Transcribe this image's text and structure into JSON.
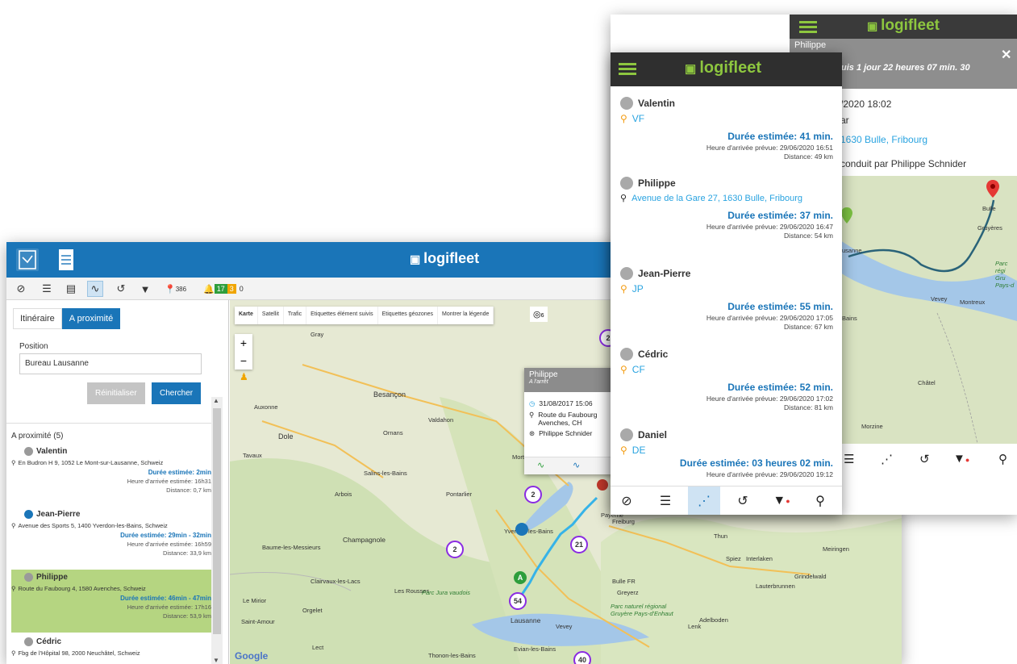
{
  "desktop": {
    "logo": "logifleet",
    "toolbar": {
      "pin_count": "386",
      "alarm_green": "17",
      "alarm_orange": "3",
      "alarm_other": "0"
    },
    "left": {
      "tabs": [
        "Itinéraire",
        "A proximité"
      ],
      "position_label": "Position",
      "position_value": "Bureau Lausanne",
      "reset_label": "Réinitialiser",
      "search_label": "Chercher",
      "nearby_title": "A proximité (5)",
      "items": [
        {
          "name": "Valentin",
          "address": "En Budron H 9, 1052 Le Mont-sur-Lausanne, Schweiz",
          "duration": "Durée estimée:   2min",
          "arrival": "Heure d'arrivée estimée:   16h31",
          "distance": "Distance:   0,7 km",
          "dot": "#9a9a9a"
        },
        {
          "name": "Jean-Pierre",
          "address": "Avenue des Sports 5, 1400 Yverdon-les-Bains, Schweiz",
          "duration": "Durée estimée:   29min - 32min",
          "arrival": "Heure d'arrivée estimée:   16h59",
          "distance": "Distance:   33,9 km",
          "dot": "#1a75b8"
        },
        {
          "name": "Philippe",
          "address": "Route du Faubourg 4, 1580 Avenches, Schweiz",
          "duration": "Durée estimée:   46min - 47min",
          "arrival": "Heure d'arrivée estimée:   17h16",
          "distance": "Distance:   53,9 km",
          "dot": "#9a9a9a"
        },
        {
          "name": "Cédric",
          "address": "Fbg de l'Hôpital 98, 2000 Neuchâtel, Schweiz",
          "dot": "#9a9a9a"
        }
      ]
    },
    "map": {
      "tabs": [
        "Karte",
        "Satellit",
        "Trafic",
        "Etiquettes élément suivis",
        "Etiquettes géozones",
        "Montrer la légende"
      ],
      "target_count": "6",
      "places": [
        {
          "name": "Besançon"
        },
        {
          "name": "Dole"
        },
        {
          "name": "Pontarlier"
        },
        {
          "name": "Champagnole"
        },
        {
          "name": "Yverdon-les-Bains"
        },
        {
          "name": "Lausanne"
        },
        {
          "name": "Vevey"
        },
        {
          "name": "Auxonne"
        },
        {
          "name": "Valdahon"
        },
        {
          "name": "Ornans"
        },
        {
          "name": "Gray"
        },
        {
          "name": "Salins-les-Bains"
        },
        {
          "name": "Arbois"
        },
        {
          "name": "Payerne"
        },
        {
          "name": "Thun"
        },
        {
          "name": "Interlaken"
        },
        {
          "name": "Spiez"
        },
        {
          "name": "Lauterbrunnen"
        },
        {
          "name": "Grindelwald"
        },
        {
          "name": "Meiringen"
        },
        {
          "name": "Thonon-les-Bains"
        },
        {
          "name": "Evian-les-Bains"
        },
        {
          "name": "Freiburg"
        },
        {
          "name": "Bulle FR"
        },
        {
          "name": "Greyerz"
        },
        {
          "name": "Parc naturel régional Gruyère Pays-d'Enhaut"
        },
        {
          "name": "Parc Jura vaudois"
        },
        {
          "name": "Morteau"
        },
        {
          "name": "Tavaux"
        },
        {
          "name": "Les Rousses"
        },
        {
          "name": "Le Mirior"
        },
        {
          "name": "Orgelet"
        },
        {
          "name": "Champagnole"
        },
        {
          "name": "Saint-Amour"
        },
        {
          "name": "Lect"
        },
        {
          "name": "Baume-les-Messieurs"
        },
        {
          "name": "Clairvaux-les-Lacs"
        },
        {
          "name": "Adelboden"
        },
        {
          "name": "Lenk"
        }
      ],
      "clusters": [
        "2",
        "2",
        "21",
        "2",
        "54",
        "40",
        "2"
      ],
      "popup": {
        "name": "Philippe",
        "status": "A l'arrêt",
        "status2": "dep",
        "time": "31/08/2017 15:06",
        "addr1": "Route du Faubourg",
        "addr2": "Avenches, CH",
        "driver": "Philippe Schnider"
      },
      "google": "Google"
    }
  },
  "tablet": {
    "logo": "logifleet",
    "gray_title": "Philippe",
    "gray_text": "uis 1 jour 22 heures 07 min. 30",
    "date": "/2020 18:02",
    "line2": "ar",
    "address": "1630 Bulle, Fribourg",
    "driver": "conduit par Philippe Schnider",
    "map_places": [
      {
        "name": "Bulle"
      },
      {
        "name": "Gruyères"
      },
      {
        "name": "Vevey"
      },
      {
        "name": "Montreux"
      },
      {
        "name": "Châtel"
      },
      {
        "name": "Morzine"
      },
      {
        "name": "Bains"
      },
      {
        "name": "usanne"
      },
      {
        "name": "Parc régi Gru Pays-d"
      }
    ]
  },
  "phone": {
    "logo": "logifleet",
    "items": [
      {
        "name": "Valentin",
        "sub": "VF",
        "sub_type": "initials",
        "duration": "Durée estimée: 41 min.",
        "arrival": "Heure d'arrivée prévue: 29/06/2020 16:51",
        "distance": "Distance: 49 km"
      },
      {
        "name": "Philippe",
        "sub": "Avenue de la Gare 27, 1630 Bulle, Fribourg",
        "sub_type": "address",
        "duration": "Durée estimée: 37 min.",
        "arrival": "Heure d'arrivée prévue: 29/06/2020 16:47",
        "distance": "Distance: 54 km"
      },
      {
        "name": "Jean-Pierre",
        "sub": "JP",
        "sub_type": "initials",
        "duration": "Durée estimée: 55 min.",
        "arrival": "Heure d'arrivée prévue: 29/06/2020 17:05",
        "distance": "Distance: 67 km"
      },
      {
        "name": "Cédric",
        "sub": "CF",
        "sub_type": "initials",
        "duration": "Durée estimée: 52 min.",
        "arrival": "Heure d'arrivée prévue: 29/06/2020 17:02",
        "distance": "Distance: 81 km"
      },
      {
        "name": "Daniel",
        "sub": "DE",
        "sub_type": "initials",
        "duration": "Durée estimée: 03 heures 02 min.",
        "arrival": "Heure d'arrivée prévue: 29/06/2020 19:12",
        "distance": ""
      }
    ]
  },
  "colors": {
    "brand_blue": "#1a75b8",
    "logo_green": "#8dc63f",
    "header_dark": "#2f2f2f",
    "link_blue": "#29a3e0",
    "pin_orange": "#f39c12",
    "highlight_green": "#b5d581"
  }
}
